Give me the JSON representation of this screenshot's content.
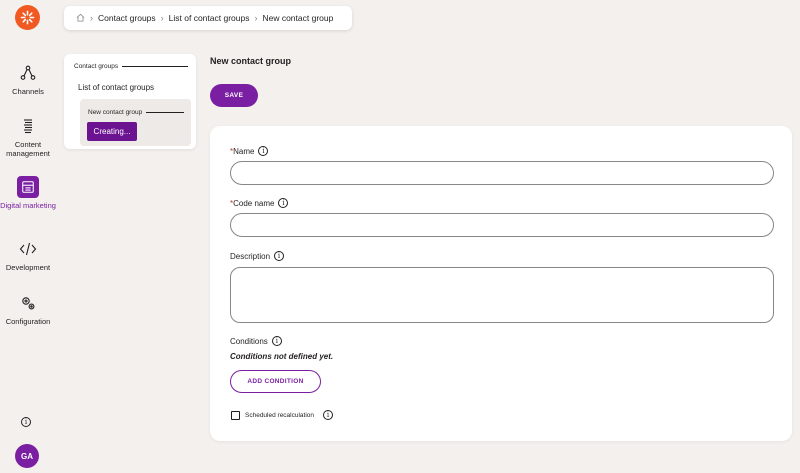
{
  "breadcrumb": {
    "items": [
      "Contact groups",
      "List of contact groups",
      "New contact group"
    ]
  },
  "rail": {
    "items": [
      {
        "label": "Channels",
        "icon": "channels-icon"
      },
      {
        "label": "Content management",
        "icon": "content-management-icon"
      },
      {
        "label": "Digital marketing",
        "icon": "digital-marketing-icon",
        "active": true
      },
      {
        "label": "Development",
        "icon": "code-icon"
      },
      {
        "label": "Configuration",
        "icon": "gears-icon"
      }
    ],
    "avatar": "GA"
  },
  "tree": {
    "header": "Contact groups",
    "list_item": "List of contact groups",
    "sub_header": "New contact group",
    "creating_label": "Creating..."
  },
  "main": {
    "title": "New contact group",
    "save_label": "SAVE",
    "fields": {
      "name_label": "Name",
      "code_name_label": "Code name",
      "description_label": "Description",
      "conditions_label": "Conditions",
      "conditions_empty": "Conditions not defined yet.",
      "add_condition_label": "ADD CONDITION",
      "scheduled_label": "Scheduled recalculation"
    }
  },
  "colors": {
    "accent": "#7a1fa2",
    "logo": "#f05a22",
    "background": "#f3f0ed"
  }
}
